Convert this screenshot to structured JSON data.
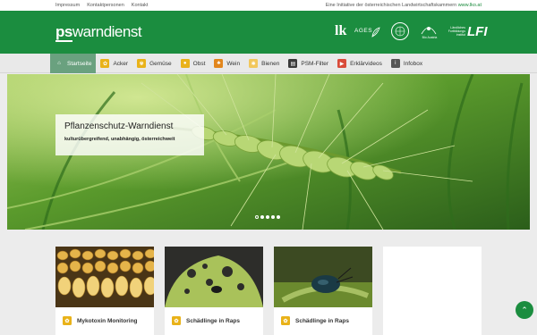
{
  "topbar": {
    "links": [
      "Impressum",
      "Kontaktpersonen",
      "Kontakt"
    ],
    "initiative_text": "Eine Initiative der österreichischen Landwirtschaftskammern ",
    "initiative_link": "www.lko.at"
  },
  "header": {
    "logo_ps": "ps",
    "logo_rest": "warndienst",
    "partner_lk": "lk",
    "partner_ages": "AGES",
    "partner_austria": "Bio Austria",
    "partner_lfi_small": "Ländliches Fortbildungs institut",
    "partner_lfi_big": "LFI"
  },
  "nav": {
    "items": [
      {
        "label": "Startseite",
        "icon": "home-icon",
        "color": "#6aa17f",
        "glyph": "⌂"
      },
      {
        "label": "Acker",
        "icon": "field-icon",
        "color": "#e9b219",
        "glyph": "✿"
      },
      {
        "label": "Gemüse",
        "icon": "vegetable-icon",
        "color": "#e9b219",
        "glyph": "✾"
      },
      {
        "label": "Obst",
        "icon": "fruit-icon",
        "color": "#e9b219",
        "glyph": "●"
      },
      {
        "label": "Wein",
        "icon": "grape-icon",
        "color": "#e2861d",
        "glyph": "♣"
      },
      {
        "label": "Bienen",
        "icon": "bee-icon",
        "color": "#f2c75c",
        "glyph": "✱"
      },
      {
        "label": "PSM-Filter",
        "icon": "filter-icon",
        "color": "#3a3a3a",
        "glyph": "▤"
      },
      {
        "label": "Erklärvideos",
        "icon": "video-icon",
        "color": "#d94b3a",
        "glyph": "▶"
      },
      {
        "label": "Infobox",
        "icon": "info-icon",
        "color": "#555555",
        "glyph": "i"
      }
    ]
  },
  "hero": {
    "title": "Pflanzenschutz-Warndienst",
    "subtitle": "kulturübergreifend, unabhängig, österreichweit",
    "slides": 5,
    "active_slide": 2
  },
  "cards": [
    {
      "label": "Mykotoxin Monitoring",
      "icon": "field-icon"
    },
    {
      "label": "Schädlinge in Raps",
      "icon": "field-icon"
    },
    {
      "label": "Schädlinge in Raps",
      "icon": "field-icon"
    }
  ],
  "colors": {
    "brand_green": "#1b8d3f",
    "nav_active": "#6aa17f",
    "crop_badge": "#e9b219"
  }
}
